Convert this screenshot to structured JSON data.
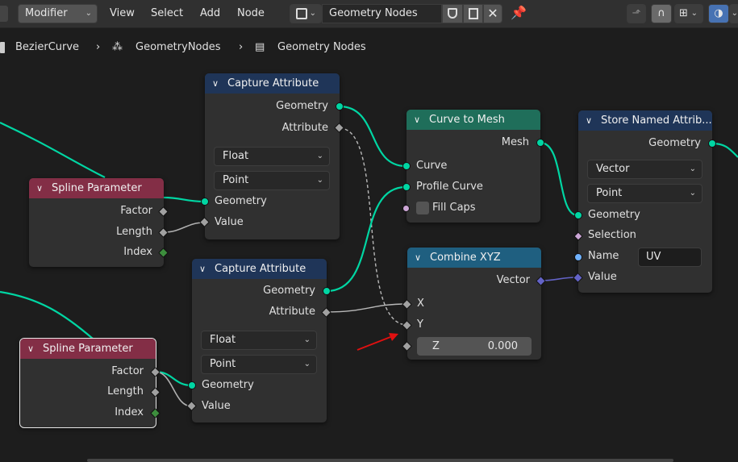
{
  "header": {
    "editor_type": "Modifier",
    "menus": [
      "View",
      "Select",
      "Add",
      "Node"
    ],
    "tree_name": "Geometry Nodes"
  },
  "breadcrumb": [
    "BezierCurve",
    "GeometryNodes",
    "Geometry Nodes"
  ],
  "nodes": {
    "capture_top": {
      "title": "Capture Attribute",
      "out_geometry": "Geometry",
      "out_attribute": "Attribute",
      "data_type": "Float",
      "domain": "Point",
      "in_geometry": "Geometry",
      "in_value": "Value"
    },
    "capture_bottom": {
      "title": "Capture Attribute",
      "out_geometry": "Geometry",
      "out_attribute": "Attribute",
      "data_type": "Float",
      "domain": "Point",
      "in_geometry": "Geometry",
      "in_value": "Value"
    },
    "spline_top": {
      "title": "Spline Parameter",
      "factor": "Factor",
      "length": "Length",
      "index": "Index"
    },
    "spline_bottom": {
      "title": "Spline Parameter",
      "factor": "Factor",
      "length": "Length",
      "index": "Index"
    },
    "curve_to_mesh": {
      "title": "Curve to Mesh",
      "out_mesh": "Mesh",
      "in_curve": "Curve",
      "in_profile": "Profile Curve",
      "fill_caps": "Fill Caps"
    },
    "combine_xyz": {
      "title": "Combine XYZ",
      "out_vector": "Vector",
      "x": "X",
      "y": "Y",
      "z_label": "Z",
      "z_value": "0.000"
    },
    "store_named": {
      "title": "Store Named Attrib...",
      "out_geometry": "Geometry",
      "data_type": "Vector",
      "domain": "Point",
      "in_geometry": "Geometry",
      "selection": "Selection",
      "name_label": "Name",
      "name_value": "UV",
      "value": "Value"
    }
  },
  "colors": {
    "geometry_socket": "#00d6a3",
    "float_socket": "#a1a1a1",
    "vector_socket": "#6363c7",
    "annotation_arrow": "#e01010"
  }
}
